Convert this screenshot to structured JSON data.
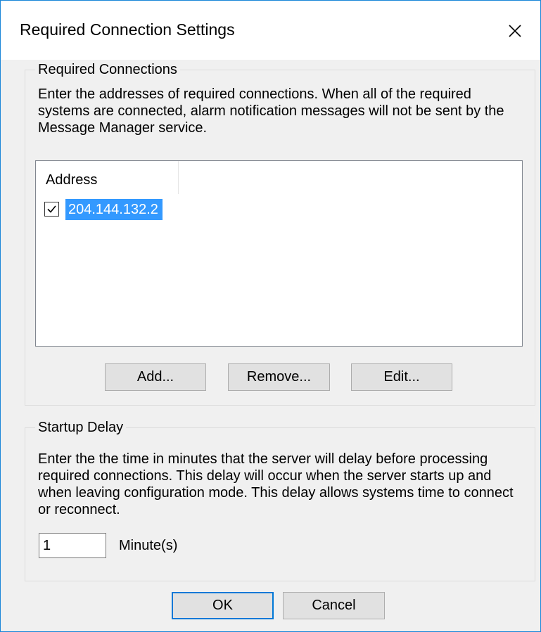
{
  "window": {
    "title": "Required Connection Settings",
    "close_icon": "close-icon"
  },
  "required_connections": {
    "group_label": "Required Connections",
    "description": "Enter the addresses of required connections. When all of the required systems are connected, alarm notification messages will not be sent by the Message Manager service.",
    "list": {
      "column_header": "Address",
      "rows": [
        {
          "checked": true,
          "address": "204.144.132.2",
          "selected": true
        }
      ]
    },
    "buttons": {
      "add": "Add...",
      "remove": "Remove...",
      "edit": "Edit..."
    }
  },
  "startup_delay": {
    "group_label": "Startup Delay",
    "description": "Enter the the time in minutes that the server will delay before processing required connections. This delay will occur when the server starts up and when leaving configuration mode. This delay allows systems time to connect or reconnect.",
    "value": "1",
    "unit_label": "Minute(s)"
  },
  "footer": {
    "ok": "OK",
    "cancel": "Cancel"
  },
  "colors": {
    "selection": "#3399ff",
    "default_button_border": "#0078d7",
    "window_border": "#1a86d8"
  }
}
